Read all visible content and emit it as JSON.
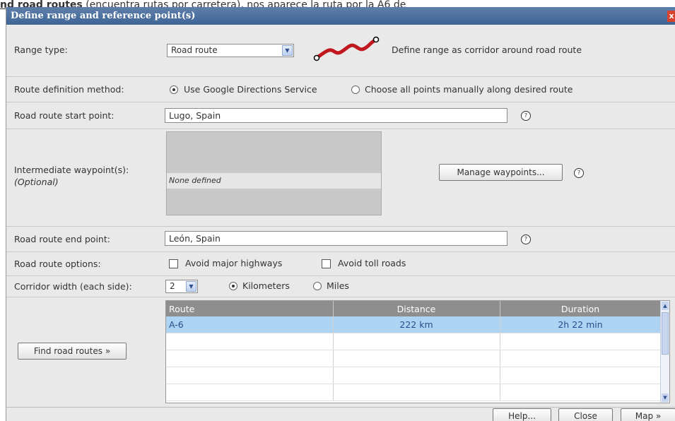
{
  "page_caption": {
    "bold": "nd road routes",
    "rest": " (encuentra rutas por carretera), nos aparece la ruta por la A6 de"
  },
  "dialog": {
    "title": "Define range and reference point(s)",
    "close": "x"
  },
  "range_type": {
    "label": "Range type:",
    "selected": "Road route",
    "description": "Define range as corridor around road route"
  },
  "route_method": {
    "label": "Route definition method:",
    "option_google": "Use Google Directions Service",
    "option_manual": "Choose all points manually along desired route",
    "selected": "google"
  },
  "start_point": {
    "label": "Road route start point:",
    "value": "Lugo, Spain",
    "help": "?"
  },
  "waypoints": {
    "label": "Intermediate waypoint(s):",
    "sublabel": "(Optional)",
    "empty_text": "None defined",
    "manage_button": "Manage waypoints...",
    "help": "?"
  },
  "end_point": {
    "label": "Road route end point:",
    "value": "León, Spain",
    "help": "?"
  },
  "road_options": {
    "label": "Road route options:",
    "avoid_highways": "Avoid major highways",
    "avoid_tolls": "Avoid toll roads",
    "avoid_highways_checked": false,
    "avoid_tolls_checked": false
  },
  "corridor": {
    "label": "Corridor width (each side):",
    "value": "2",
    "unit_km": "Kilometers",
    "unit_miles": "Miles",
    "selected_unit": "km"
  },
  "find_button": "Find road routes »",
  "routes_table": {
    "headers": [
      "Route",
      "Distance",
      "Duration"
    ],
    "rows": [
      {
        "route": "A-6",
        "distance": "222 km",
        "duration": "2h 22 min"
      }
    ]
  },
  "footer": {
    "help": "Help...",
    "close": "Close",
    "map": "Map »"
  }
}
